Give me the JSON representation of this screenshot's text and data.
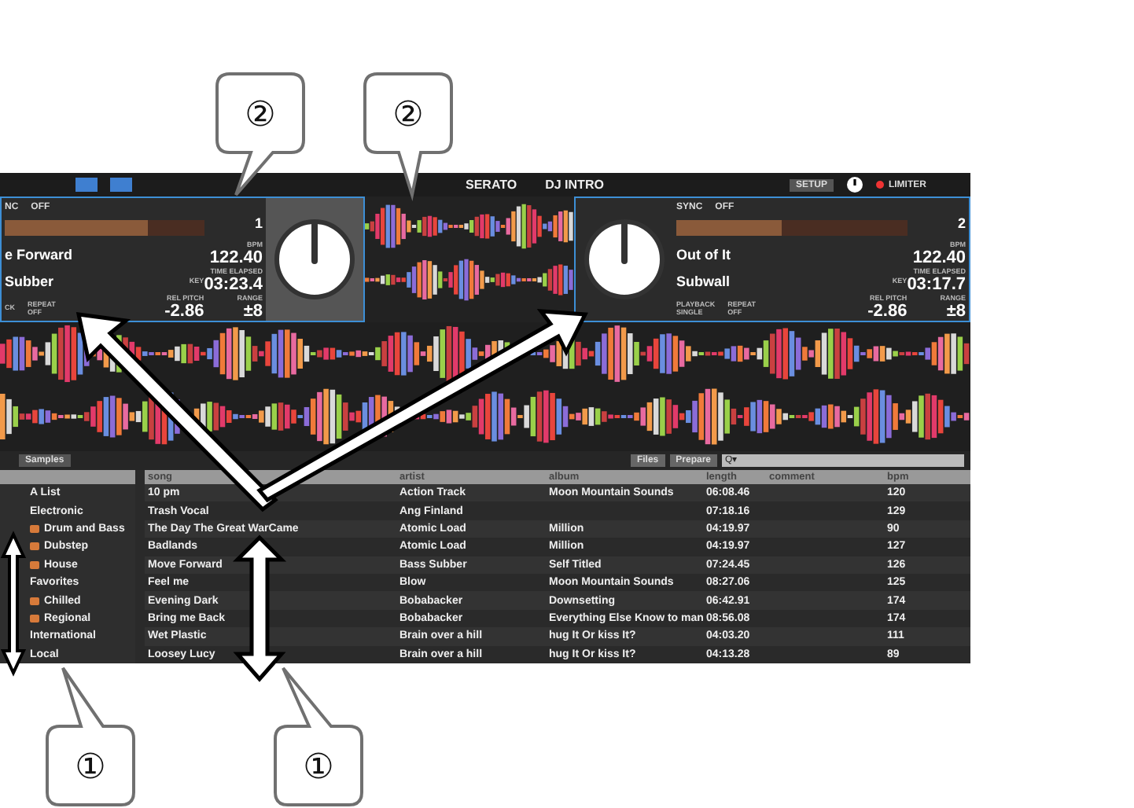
{
  "top_bar": {
    "brand": "SERATO",
    "title": "DJ INTRO",
    "setup": "SETUP",
    "limiter": "LIMITER"
  },
  "decks": [
    {
      "sync": "NC",
      "sync_state": "OFF",
      "deck_number": "1",
      "title": "e Forward",
      "artist": "Subber",
      "bpm_label": "BPM",
      "bpm": "122.40",
      "key_label": "KEY",
      "time_label": "TIME ELAPSED",
      "time": "03:23.4",
      "playback_label": "CK",
      "repeat_label": "REPEAT",
      "repeat": "OFF",
      "pitch_label": "REL PITCH",
      "pitch": "-2.86",
      "range_label": "RANGE",
      "range": "±8",
      "level": 0.72
    },
    {
      "sync": "SYNC",
      "sync_state": "OFF",
      "deck_number": "2",
      "title": "Out of It",
      "artist": "Subwall",
      "bpm_label": "BPM",
      "bpm": "122.40",
      "key_label": "KEY",
      "time_label": "TIME ELAPSED",
      "time": "03:17.7",
      "playback_label": "PLAYBACK",
      "playback": "SINGLE",
      "repeat_label": "REPEAT",
      "repeat": "OFF",
      "pitch_label": "REL PITCH",
      "pitch": "-2.86",
      "range_label": "RANGE",
      "range": "±8",
      "level": 0.46
    }
  ],
  "panel_tabs": [
    "Samples"
  ],
  "library_buttons": [
    "Files",
    "Prepare"
  ],
  "search": {
    "placeholder": "Q▾"
  },
  "sidebar": {
    "items": [
      {
        "label": "A List",
        "kind": "list"
      },
      {
        "label": "Electronic",
        "kind": "list"
      },
      {
        "label": "Drum and Bass",
        "kind": "crate"
      },
      {
        "label": "Dubstep",
        "kind": "crate"
      },
      {
        "label": "House",
        "kind": "crate"
      },
      {
        "label": "Favorites",
        "kind": "list"
      },
      {
        "label": "Chilled",
        "kind": "crate"
      },
      {
        "label": "Regional",
        "kind": "crate"
      },
      {
        "label": "International",
        "kind": "list"
      },
      {
        "label": "Local",
        "kind": "list"
      }
    ]
  },
  "table": {
    "columns": [
      "song",
      "artist",
      "album",
      "length",
      "comment",
      "bpm"
    ],
    "rows": [
      [
        "10 pm",
        "Action Track",
        "Moon Mountain Sounds",
        "06:08.46",
        "",
        "120"
      ],
      [
        "Trash Vocal",
        "Ang Finland",
        "",
        "07:18.16",
        "",
        "129"
      ],
      [
        "The Day The Great WarCame",
        "Atomic Load",
        "Million",
        "04:19.97",
        "",
        "90"
      ],
      [
        "Badlands",
        "Atomic Load",
        "Million",
        "04:19.97",
        "",
        "127"
      ],
      [
        "Move Forward",
        "Bass Subber",
        "Self Titled",
        "07:24.45",
        "",
        "126"
      ],
      [
        "Feel me",
        "Blow",
        "Moon Mountain Sounds",
        "08:27.06",
        "",
        "125"
      ],
      [
        "Evening Dark",
        "Bobabacker",
        "Downsetting",
        "06:42.91",
        "",
        "174"
      ],
      [
        "Bring me Back",
        "Bobabacker",
        "Everything Else Know to man",
        "08:56.08",
        "",
        "174"
      ],
      [
        "Wet Plastic",
        "Brain over a hill",
        "hug It Or kiss It?",
        "04:03.20",
        "",
        "111"
      ],
      [
        "Loosey Lucy",
        "Brain over a hill",
        "hug It Or kiss It?",
        "04:13.28",
        "",
        "89"
      ]
    ]
  },
  "callouts": [
    {
      "label": "②"
    },
    {
      "label": "②"
    },
    {
      "label": "①"
    },
    {
      "label": "①"
    }
  ]
}
